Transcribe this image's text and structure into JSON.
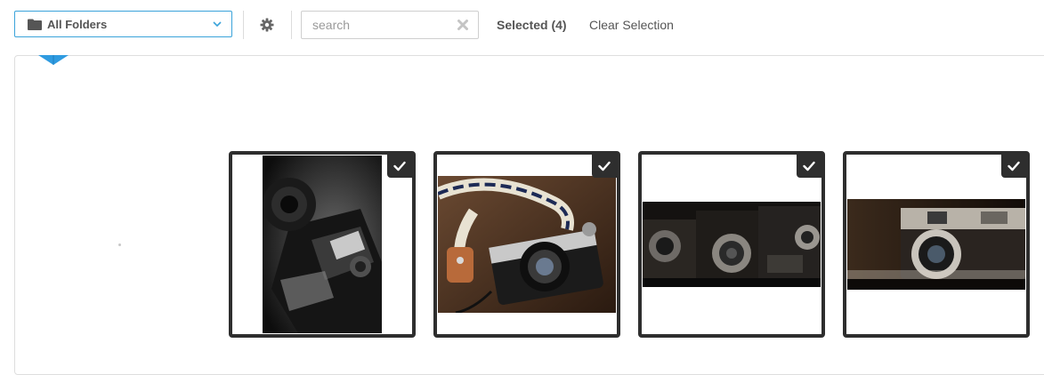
{
  "toolbar": {
    "folder_select": {
      "label": "All Folders",
      "icon": "folder-icon",
      "chevron": "chevron-down-icon",
      "border_color": "#3aa3da"
    },
    "settings": {
      "icon": "gear-icon"
    },
    "search": {
      "placeholder": "search",
      "value": "",
      "clear_icon": "close-icon"
    },
    "selected_label": "Selected (4)",
    "clear_selection_label": "Clear Selection"
  },
  "gallery": {
    "items": [
      {
        "name": "camera-photo-1",
        "selected": true,
        "tone": "black-and-white"
      },
      {
        "name": "camera-photo-2",
        "selected": true,
        "tone": "warm"
      },
      {
        "name": "camera-photo-3",
        "selected": true,
        "tone": "dark"
      },
      {
        "name": "camera-photo-4",
        "selected": true,
        "tone": "sepia"
      }
    ],
    "check_icon": "check-icon",
    "frame_color": "#2e2e2e"
  },
  "accent_color": "#2f9be0"
}
